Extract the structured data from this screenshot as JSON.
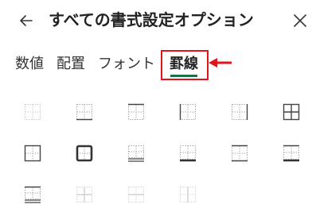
{
  "header": {
    "title": "すべての書式設定オプション",
    "back_icon": "arrow-left-icon",
    "close_icon": "close-icon"
  },
  "tabs": [
    {
      "label": "数値",
      "selected": false
    },
    {
      "label": "配置",
      "selected": false
    },
    {
      "label": "フォント",
      "selected": false
    },
    {
      "label": "罫線",
      "selected": true
    }
  ],
  "annotation": {
    "highlight_color": "#e0151c",
    "pointer_icon": "red-arrow-pointer-icon"
  },
  "colors": {
    "accent": "#1e7145",
    "text": "#222222",
    "icon_dark": "#444444",
    "icon_disabled": "#c8c8c8"
  },
  "border_options": [
    {
      "icon": "no-border-icon"
    },
    {
      "icon": "bottom-border-icon"
    },
    {
      "icon": "top-border-icon"
    },
    {
      "icon": "left-border-icon"
    },
    {
      "icon": "right-border-icon"
    },
    {
      "icon": "all-borders-icon"
    },
    {
      "icon": "outside-borders-icon"
    },
    {
      "icon": "thick-box-border-icon"
    },
    {
      "icon": "bottom-double-border-icon"
    },
    {
      "icon": "thick-bottom-border-icon"
    },
    {
      "icon": "top-bottom-border-icon"
    },
    {
      "icon": "top-thick-bottom-border-icon"
    },
    {
      "icon": "top-double-bottom-border-icon"
    },
    {
      "icon": "inside-borders-icon"
    },
    {
      "icon": "inside-horizontal-border-icon"
    },
    {
      "icon": "inside-vertical-border-icon"
    }
  ]
}
